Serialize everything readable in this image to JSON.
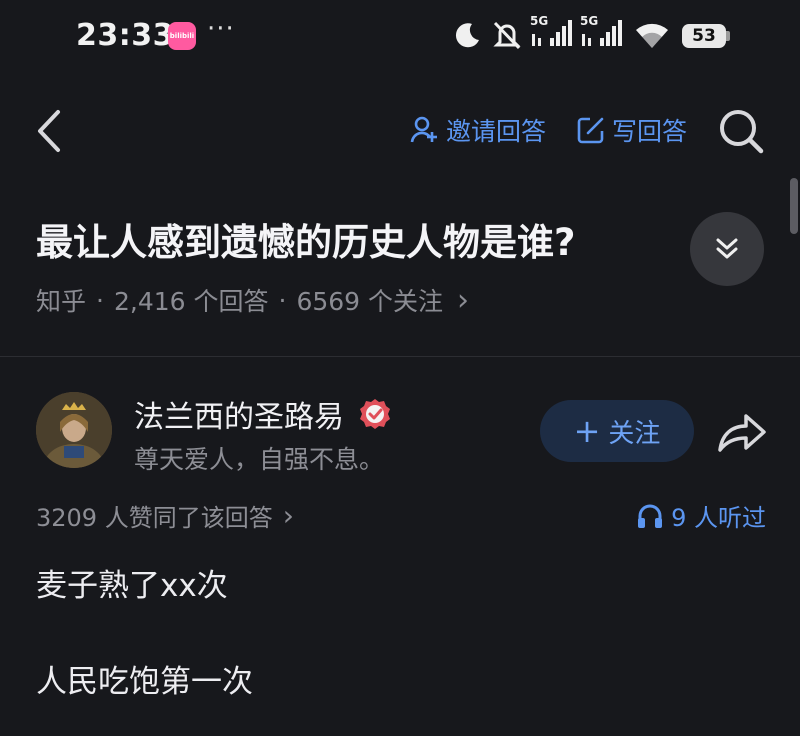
{
  "status_bar": {
    "time": "23:33",
    "app_icon_text": "bilibili",
    "more": "···",
    "signal_label_1": "5G",
    "signal_label_2": "5G",
    "battery": "53"
  },
  "header": {
    "invite_label": "邀请回答",
    "write_label": "写回答"
  },
  "question": {
    "title": "最让人感到遗憾的历史人物是谁?",
    "source": "知乎",
    "sep1": "·",
    "answers": "2,416 个回答",
    "sep2": "·",
    "followers": "6569 个关注",
    "arrow": "›"
  },
  "author": {
    "name": "法兰西的圣路易",
    "bio": "尊天爱人，自强不息。",
    "follow_label": "关注",
    "follow_plus": "+"
  },
  "stats": {
    "likes": "3209 人赞同了该回答",
    "likes_arrow": "›",
    "listened": "9 人听过"
  },
  "content": {
    "paragraphs": [
      "麦子熟了xx次",
      "人民吃饱第一次"
    ]
  },
  "colors": {
    "background": "#17181c",
    "accent": "#5b95f0",
    "verified": "#e0505a"
  }
}
